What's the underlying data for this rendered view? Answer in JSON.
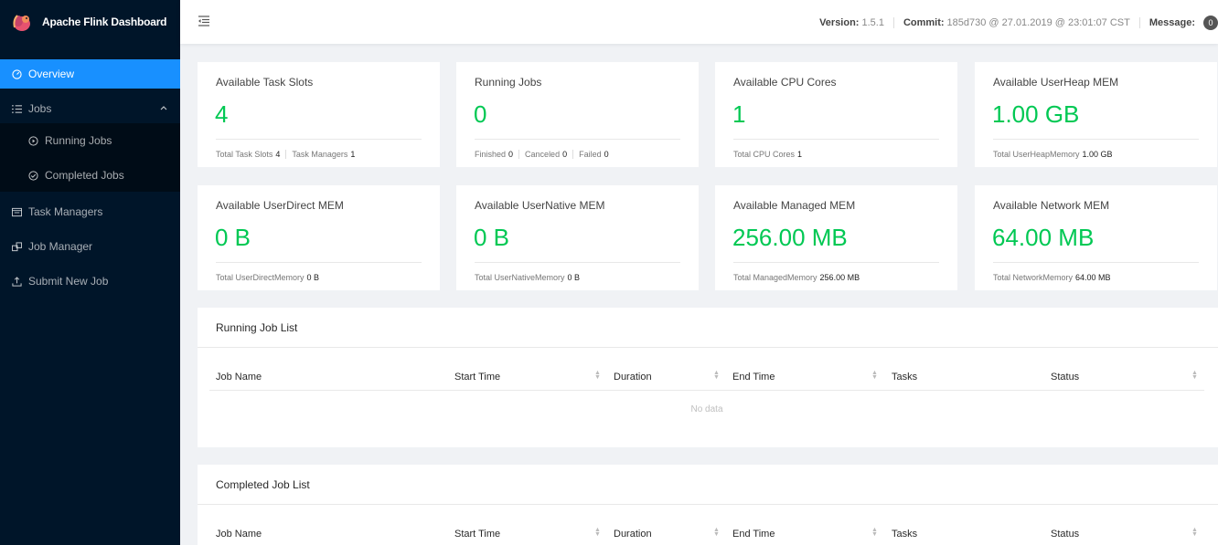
{
  "app": {
    "title": "Apache Flink Dashboard"
  },
  "sidebar": {
    "items": [
      {
        "label": "Overview",
        "icon": "dashboard-icon",
        "active": true
      },
      {
        "label": "Jobs",
        "icon": "list-icon",
        "expanded": true
      },
      {
        "label": "Running Jobs",
        "icon": "play-circle-icon"
      },
      {
        "label": "Completed Jobs",
        "icon": "check-circle-icon"
      },
      {
        "label": "Task Managers",
        "icon": "schedule-icon"
      },
      {
        "label": "Job Manager",
        "icon": "build-icon"
      },
      {
        "label": "Submit New Job",
        "icon": "upload-icon"
      }
    ]
  },
  "header": {
    "version_label": "Version:",
    "version_value": "1.5.1",
    "commit_label": "Commit:",
    "commit_value": "185d730 @ 27.01.2019 @ 23:01:07 CST",
    "message_label": "Message:",
    "message_count": "0"
  },
  "stats": [
    {
      "title": "Available Task Slots",
      "value": "4",
      "footer": [
        {
          "label": "Total Task Slots",
          "value": "4"
        },
        {
          "label": "Task Managers",
          "value": "1"
        }
      ]
    },
    {
      "title": "Running Jobs",
      "value": "0",
      "footer": [
        {
          "label": "Finished",
          "value": "0"
        },
        {
          "label": "Canceled",
          "value": "0"
        },
        {
          "label": "Failed",
          "value": "0"
        }
      ]
    },
    {
      "title": "Available CPU Cores",
      "value": "1",
      "footer": [
        {
          "label": "Total CPU Cores",
          "value": "1"
        }
      ]
    },
    {
      "title": "Available UserHeap MEM",
      "value": "1.00 GB",
      "footer": [
        {
          "label": "Total UserHeapMemory",
          "value": "1.00 GB"
        }
      ]
    },
    {
      "title": "Available UserDirect MEM",
      "value": "0 B",
      "footer": [
        {
          "label": "Total UserDirectMemory",
          "value": "0 B"
        }
      ]
    },
    {
      "title": "Available UserNative MEM",
      "value": "0 B",
      "footer": [
        {
          "label": "Total UserNativeMemory",
          "value": "0 B"
        }
      ]
    },
    {
      "title": "Available Managed MEM",
      "value": "256.00 MB",
      "footer": [
        {
          "label": "Total ManagedMemory",
          "value": "256.00 MB"
        }
      ]
    },
    {
      "title": "Available Network MEM",
      "value": "64.00 MB",
      "footer": [
        {
          "label": "Total NetworkMemory",
          "value": "64.00 MB"
        }
      ]
    }
  ],
  "running_jobs": {
    "title": "Running Job List",
    "columns": [
      "Job Name",
      "Start Time",
      "Duration",
      "End Time",
      "Tasks",
      "Status"
    ],
    "empty_text": "No data"
  },
  "completed_jobs": {
    "title": "Completed Job List",
    "columns": [
      "Job Name",
      "Start Time",
      "Duration",
      "End Time",
      "Tasks",
      "Status"
    ]
  },
  "colors": {
    "sidebar_bg": "#001529",
    "accent": "#1890ff",
    "stat_value": "#00c853"
  }
}
